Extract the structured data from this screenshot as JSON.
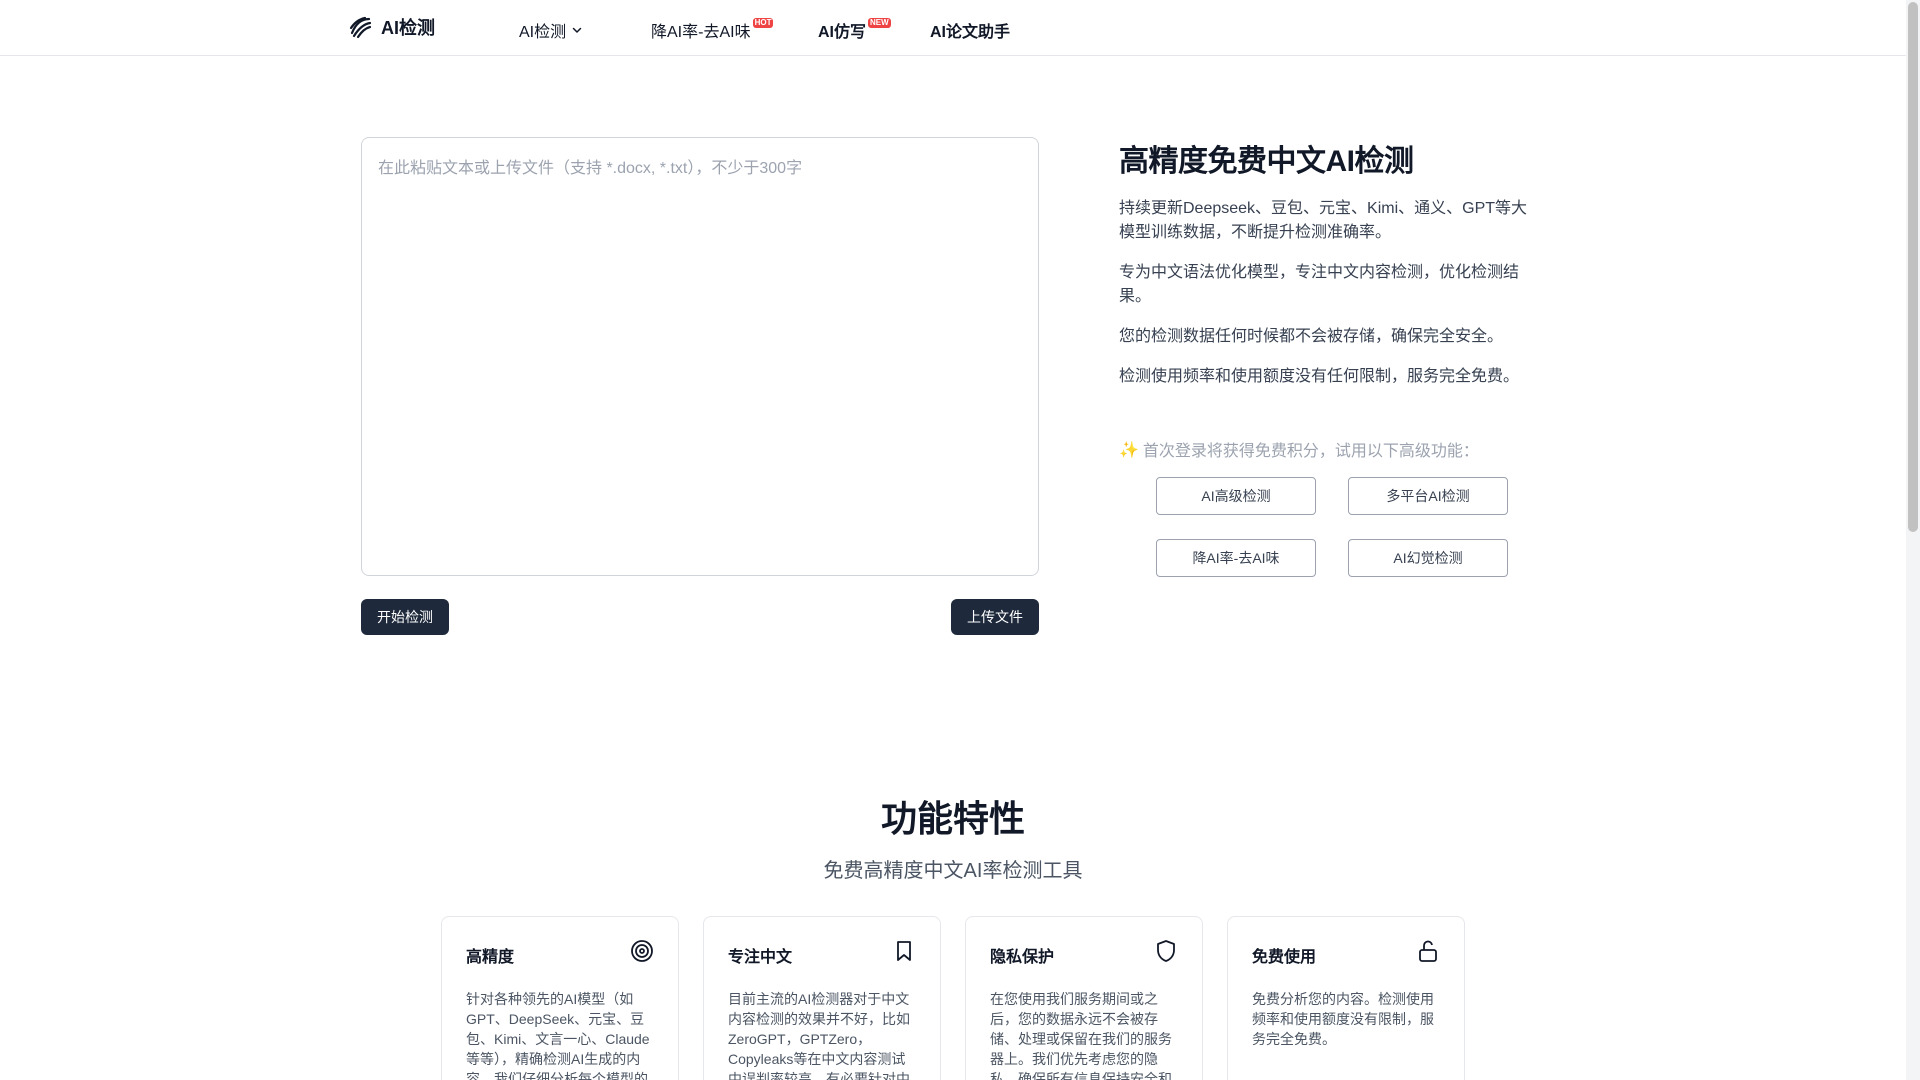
{
  "header": {
    "logo_text": "AI检测",
    "nav": [
      {
        "label": "AI检测"
      },
      {
        "label": "降AI率-去AI味",
        "badge": "HOT"
      },
      {
        "label": "AI仿写",
        "badge": "NEW"
      },
      {
        "label": "AI论文助手"
      }
    ]
  },
  "editor": {
    "placeholder": "在此粘贴文本或上传文件（支持 *.docx, *.txt），不少于300字",
    "start_button": "开始检测",
    "upload_button": "上传文件"
  },
  "hero": {
    "title": "高精度免费中文AI检测",
    "paragraphs": [
      "持续更新Deepseek、豆包、元宝、Kimi、通义、GPT等大模型训练数据，不断提升检测准确率。",
      "专为中文语法优化模型，专注中文内容检测，优化检测结果。",
      "您的检测数据任何时候都不会被存储，确保完全安全。",
      "检测使用频率和使用额度没有任何限制，服务完全免费。"
    ],
    "promo_icon": "✨",
    "promo_text": "首次登录将获得免费积分，试用以下高级功能：",
    "promo_buttons": [
      "AI高级检测",
      "多平台AI检测",
      "降AI率-去AI味",
      "AI幻觉检测"
    ]
  },
  "features": {
    "title": "功能特性",
    "subtitle": "免费高精度中文AI率检测工具",
    "cards": [
      {
        "title": "高精度",
        "icon": "target-icon",
        "desc": "针对各种领先的AI模型（如GPT、DeepSeek、元宝、豆包、Kimi、文言一心、Claude等等），精确检测AI生成的内容，我们仔细分析每个模型的"
      },
      {
        "title": "专注中文",
        "icon": "bookmark-icon",
        "desc": "目前主流的AI检测器对于中文内容检测的效果并不好，比如ZeroGPT，GPTZero，Copyleaks等在中文内容测试中误判率较高，有必要针对中"
      },
      {
        "title": "隐私保护",
        "icon": "shield-icon",
        "desc": "在您使用我们服务期间或之后，您的数据永远不会被存储、处理或保留在我们的服务器上。我们优先考虑您的隐私，确保所有信息保持安全和"
      },
      {
        "title": "免费使用",
        "icon": "unlock-icon",
        "desc": "免费分析您的内容。检测使用频率和使用额度没有限制，服务完全免费。"
      }
    ]
  },
  "colors": {
    "primary_dark": "#1e293b",
    "badge_red": "#ef4444",
    "text": "#111827",
    "muted": "#9ca3af"
  }
}
